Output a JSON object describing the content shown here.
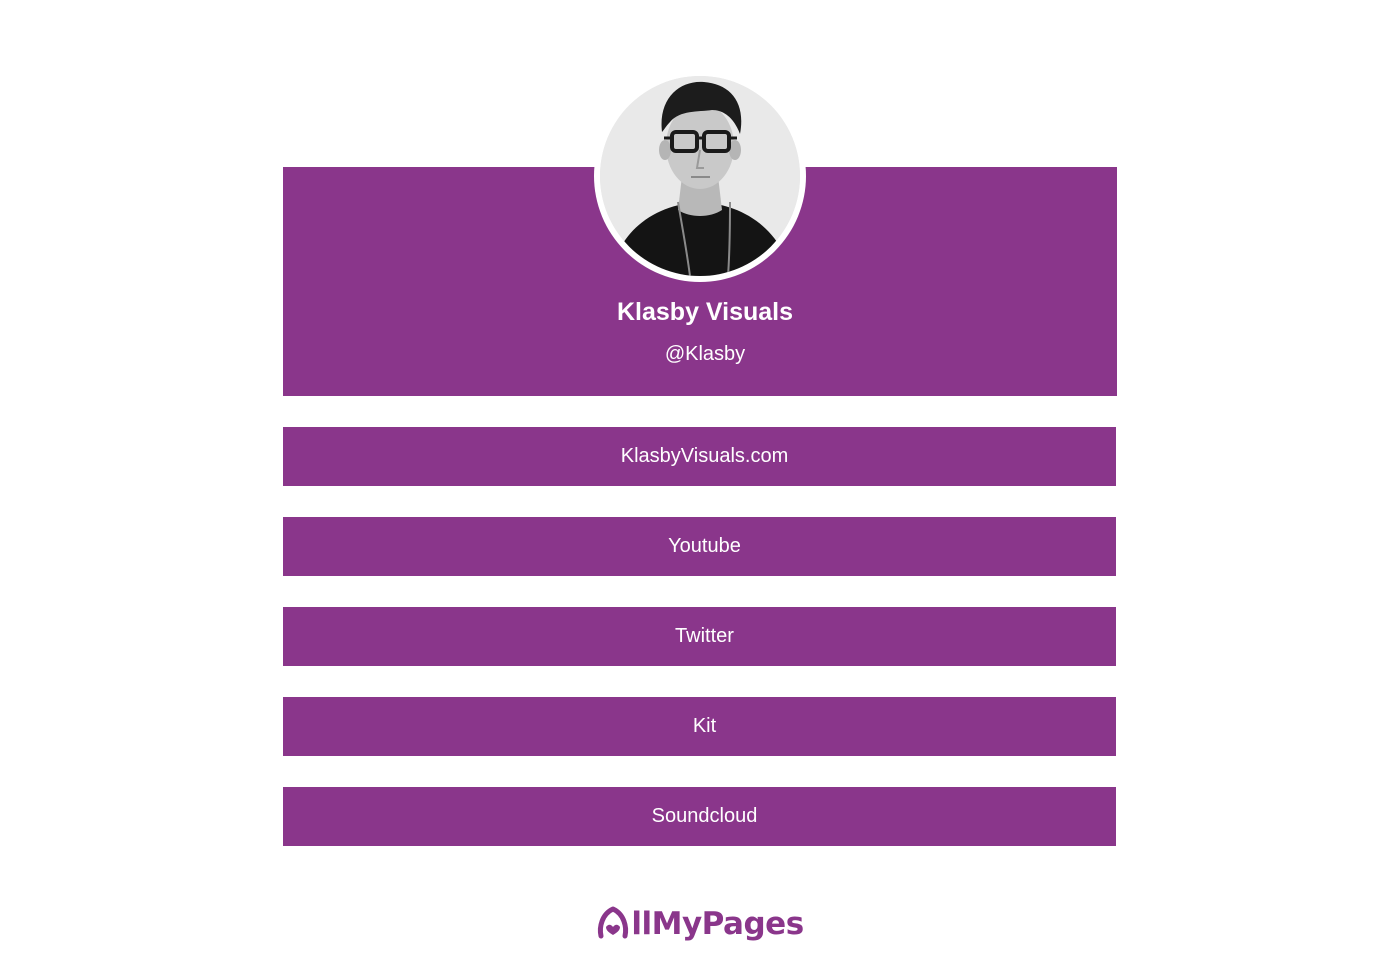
{
  "profile": {
    "name": "Klasby Visuals",
    "handle": "@Klasby",
    "avatar_icon": "profile-photo"
  },
  "links": [
    {
      "label": "KlasbyVisuals.com"
    },
    {
      "label": "Youtube"
    },
    {
      "label": "Twitter"
    },
    {
      "label": "Kit"
    },
    {
      "label": "Soundcloud"
    }
  ],
  "footer": {
    "brand": "llMyPages",
    "brand_icon": "allmypages-a-logo"
  },
  "colors": {
    "accent": "#8a368b",
    "background": "#ffffff",
    "text_on_accent": "#ffffff"
  }
}
